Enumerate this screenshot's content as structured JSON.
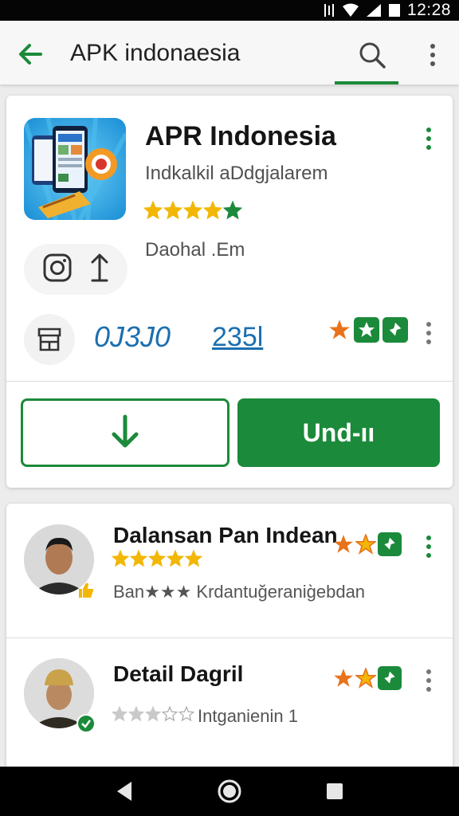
{
  "status_bar": {
    "time": "12:28"
  },
  "app_bar": {
    "search_query": "APK indonaesia"
  },
  "app_card": {
    "name": "APR Indonesia",
    "developer": "Indkalkil aDdgjalarem",
    "rating_stars": 4.5,
    "download_size": "Daohal .Em",
    "stat_left": "0J3J0",
    "stat_right": "235l",
    "install_button_label": "Und‑ıı"
  },
  "list": {
    "items": [
      {
        "title": "Dalansan Pan Indean",
        "subtitle": "Ban★★★ Krdantuğeranig̀ebdan",
        "stars": 4.5
      },
      {
        "title": "Detail Dagril",
        "subtitle": "Intganienin 1",
        "stars": 3
      }
    ]
  },
  "colors": {
    "accent_green": "#1b8a3a",
    "star_gold": "#f2b705",
    "stat_blue": "#1b6fb0",
    "orange": "#e8731a"
  },
  "icons": {
    "back": "arrow-left-icon",
    "search": "search-icon",
    "more": "more-vert-icon",
    "instagram": "instagram-icon",
    "share": "upload-icon",
    "store": "store-icon",
    "download": "download-arrow-icon"
  }
}
